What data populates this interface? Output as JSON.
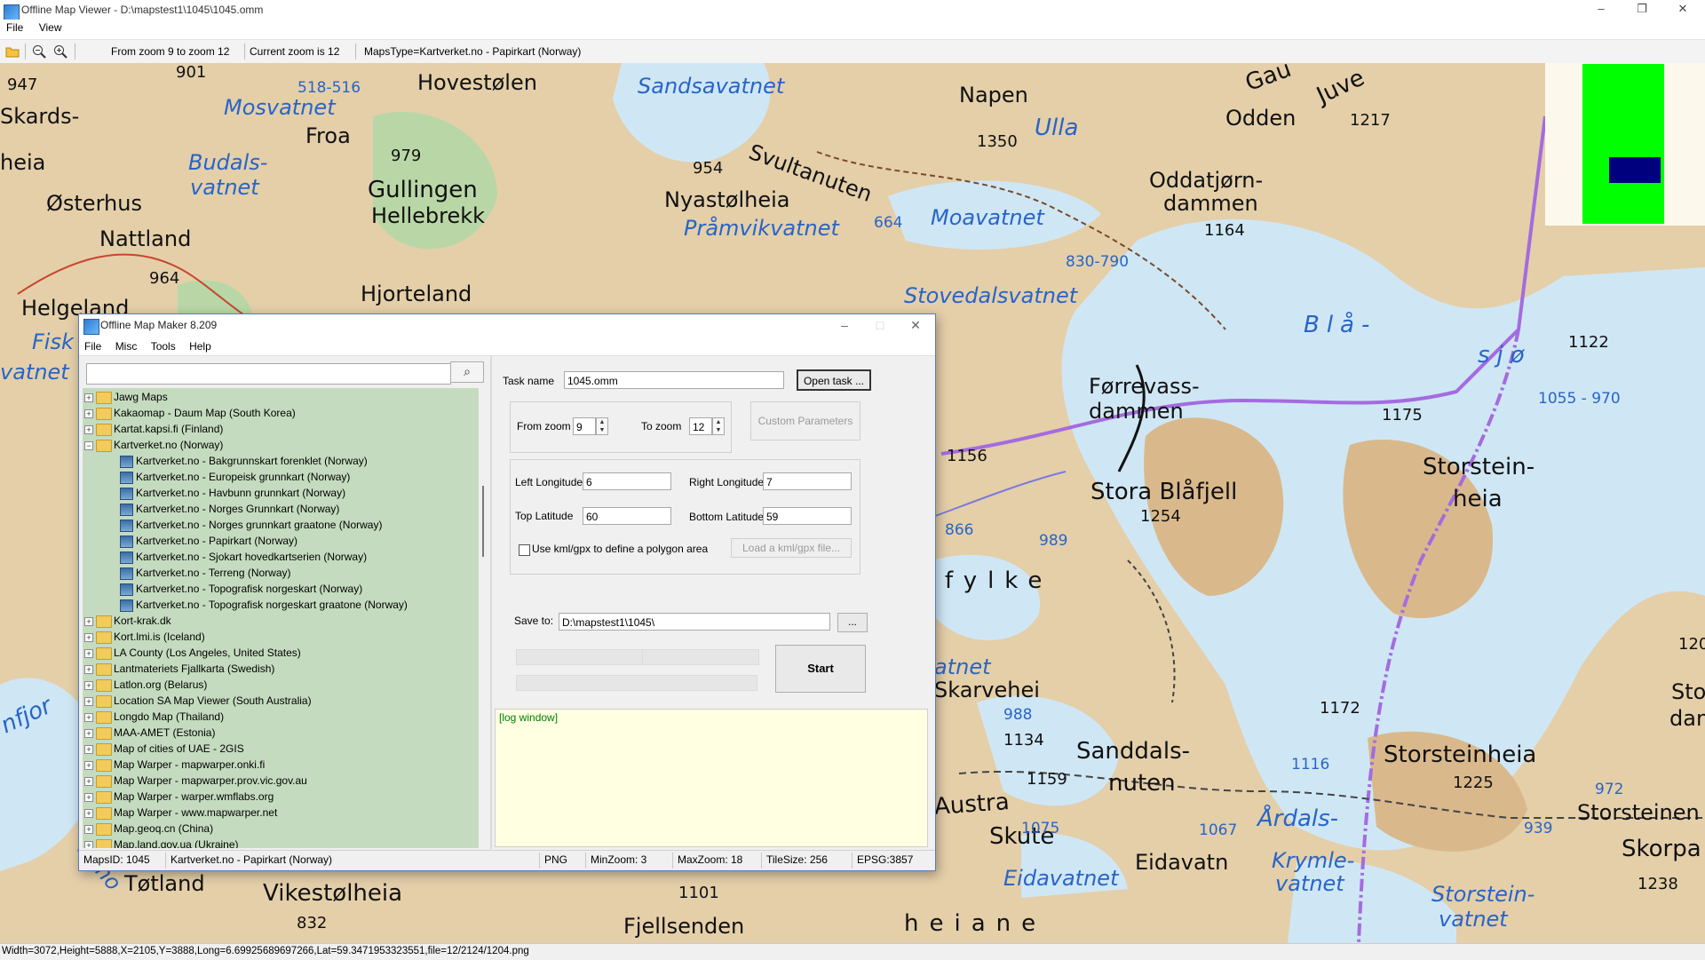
{
  "window": {
    "title": "Offline Map Viewer - D:\\mapstest1\\1045\\1045.omm",
    "minimize": "–",
    "restore": "❐",
    "close": "✕"
  },
  "menu": [
    "File",
    "View"
  ],
  "toolbar": {
    "zoom_range": "From zoom 9 to zoom 12",
    "current_zoom": "Current zoom is 12",
    "maps_type": "MapsType=Kartverket.no - Papirkart (Norway)",
    "icons": [
      "open-folder-icon",
      "zoom-out-icon",
      "zoom-in-icon"
    ]
  },
  "map": {
    "labels": [
      {
        "text": "947",
        "cls": "num"
      },
      {
        "text": "901",
        "cls": "num"
      },
      {
        "text": "518-516",
        "cls": "numblue"
      },
      {
        "text": "Hovestølen",
        "cls": "med"
      },
      {
        "text": "Sandsavatnet",
        "cls": "water med"
      },
      {
        "text": "Napen",
        "cls": "med"
      },
      {
        "text": "Odden",
        "cls": "med"
      },
      {
        "text": "1217",
        "cls": "num"
      },
      {
        "text": "Skards-",
        "cls": "med"
      },
      {
        "text": "Mosvatnet",
        "cls": "water med"
      },
      {
        "text": "Froa",
        "cls": "med"
      },
      {
        "text": "1350",
        "cls": "num"
      },
      {
        "text": "Ulla",
        "cls": "water big"
      },
      {
        "text": "heia",
        "cls": "med"
      },
      {
        "text": "Budals-",
        "cls": "water med"
      },
      {
        "text": "vatnet",
        "cls": "water med"
      },
      {
        "text": "979",
        "cls": "num"
      },
      {
        "text": "954",
        "cls": "num"
      },
      {
        "text": "Svultanuten",
        "cls": "med"
      },
      {
        "text": "Oddatjørn-",
        "cls": "med"
      },
      {
        "text": "dammen",
        "cls": "med"
      },
      {
        "text": "Østerhus",
        "cls": "med"
      },
      {
        "text": "Gullingen",
        "cls": "big"
      },
      {
        "text": "Hellebrekk",
        "cls": "med"
      },
      {
        "text": "Nyastølheia",
        "cls": "med"
      },
      {
        "text": "Pråmvikvatnet",
        "cls": "water med"
      },
      {
        "text": "664",
        "cls": "numblue"
      },
      {
        "text": "Moavatnet",
        "cls": "water med"
      },
      {
        "text": "1164",
        "cls": "num"
      },
      {
        "text": "Nattland",
        "cls": "med"
      },
      {
        "text": "830-790",
        "cls": "numblue"
      },
      {
        "text": "964",
        "cls": "num"
      },
      {
        "text": "Hjorteland",
        "cls": "med"
      },
      {
        "text": "Helgeland",
        "cls": "med"
      },
      {
        "text": "Stovedalsvatnet",
        "cls": "water med"
      },
      {
        "text": "Blå-",
        "cls": "water big"
      },
      {
        "text": "sjø",
        "cls": "water big"
      },
      {
        "text": "1122",
        "cls": "num"
      },
      {
        "text": "Førrevass-",
        "cls": "med"
      },
      {
        "text": "dammen",
        "cls": "med"
      },
      {
        "text": "1175",
        "cls": "num"
      },
      {
        "text": "1055 - 970",
        "cls": "numblue"
      },
      {
        "text": "1156",
        "cls": "num"
      },
      {
        "text": "Stora Blåfjell",
        "cls": "big"
      },
      {
        "text": "Storstein-",
        "cls": "big"
      },
      {
        "text": "heia",
        "cls": "big"
      },
      {
        "text": "1254",
        "cls": "num"
      },
      {
        "text": "866",
        "cls": "numblue"
      },
      {
        "text": "989",
        "cls": "numblue"
      },
      {
        "text": "fylke",
        "cls": "big"
      },
      {
        "text": "Skarvehei",
        "cls": "med"
      },
      {
        "text": "988",
        "cls": "numblue"
      },
      {
        "text": "1172",
        "cls": "num"
      },
      {
        "text": "1134",
        "cls": "num"
      },
      {
        "text": "Sanddals-",
        "cls": "big"
      },
      {
        "text": "nuten",
        "cls": "big"
      },
      {
        "text": "1159",
        "cls": "num"
      },
      {
        "text": "1116",
        "cls": "numblue"
      },
      {
        "text": "Storsteinheia",
        "cls": "big"
      },
      {
        "text": "1225",
        "cls": "num"
      },
      {
        "text": "Austra",
        "cls": "big"
      },
      {
        "text": "Skute",
        "cls": "big"
      },
      {
        "text": "1075",
        "cls": "numblue"
      },
      {
        "text": "1067",
        "cls": "numblue"
      },
      {
        "text": "Årdals-",
        "cls": "water big"
      },
      {
        "text": "Krymle-",
        "cls": "water med"
      },
      {
        "text": "vatnet",
        "cls": "water med"
      },
      {
        "text": "Storsteinen",
        "cls": "med"
      },
      {
        "text": "939",
        "cls": "numblue"
      },
      {
        "text": "972",
        "cls": "numblue"
      },
      {
        "text": "Eidavatnet",
        "cls": "water med"
      },
      {
        "text": "Eidavatn",
        "cls": "med"
      },
      {
        "text": "Storstein-",
        "cls": "water med"
      },
      {
        "text": "vatnet",
        "cls": "water med"
      },
      {
        "text": "1238",
        "cls": "num"
      },
      {
        "text": "Tøtland",
        "cls": "med"
      },
      {
        "text": "Vikestølheia",
        "cls": "big"
      },
      {
        "text": "1101",
        "cls": "num"
      },
      {
        "text": "832",
        "cls": "num"
      },
      {
        "text": "Fjellsenden",
        "cls": "med"
      },
      {
        "text": "heiane",
        "cls": "big"
      },
      {
        "text": "120",
        "cls": "num"
      },
      {
        "text": "Stor",
        "cls": "med"
      },
      {
        "text": "dan",
        "cls": "med"
      },
      {
        "text": "Skorpa",
        "cls": "big"
      },
      {
        "text": "Fisk",
        "cls": "water med"
      },
      {
        "text": "vatnet",
        "cls": "water med"
      },
      {
        "text": "nfjor",
        "cls": "water big"
      },
      {
        "text": "ormo",
        "cls": "water med"
      },
      {
        "text": "Gau",
        "cls": "big"
      },
      {
        "text": "Juve",
        "cls": "big"
      },
      {
        "text": "atnet",
        "cls": "water med"
      }
    ]
  },
  "statusbar": "Width=3072,Height=5888,X=2105,Y=3888,Long=6.69925689697266,Lat=59.3471953323551,file=12/2124/1204.png",
  "dialog": {
    "title": "Offline Map Maker 8.209",
    "menu": [
      "File",
      "Misc",
      "Tools",
      "Help"
    ],
    "search_placeholder": "",
    "search_icon": "⌕",
    "tree": [
      {
        "text": "Jawg Maps",
        "level": 0,
        "type": "folder",
        "exp": "+"
      },
      {
        "text": "Kakaomap - Daum Map (South Korea)",
        "level": 0,
        "type": "folder",
        "exp": "+"
      },
      {
        "text": "Kartat.kapsi.fi (Finland)",
        "level": 0,
        "type": "folder",
        "exp": "+"
      },
      {
        "text": "Kartverket.no (Norway)",
        "level": 0,
        "type": "folder-open",
        "exp": "−"
      },
      {
        "text": "Kartverket.no - Bakgrunnskart forenklet (Norway)",
        "level": 1,
        "type": "map"
      },
      {
        "text": "Kartverket.no - Europeisk grunnkart (Norway)",
        "level": 1,
        "type": "map"
      },
      {
        "text": "Kartverket.no - Havbunn grunnkart (Norway)",
        "level": 1,
        "type": "map"
      },
      {
        "text": "Kartverket.no - Norges Grunnkart (Norway)",
        "level": 1,
        "type": "map"
      },
      {
        "text": "Kartverket.no - Norges grunnkart graatone (Norway)",
        "level": 1,
        "type": "map"
      },
      {
        "text": "Kartverket.no - Papirkart (Norway)",
        "level": 1,
        "type": "map"
      },
      {
        "text": "Kartverket.no - Sjokart hovedkartserien (Norway)",
        "level": 1,
        "type": "map"
      },
      {
        "text": "Kartverket.no - Terreng (Norway)",
        "level": 1,
        "type": "map"
      },
      {
        "text": "Kartverket.no - Topografisk norgeskart (Norway)",
        "level": 1,
        "type": "map"
      },
      {
        "text": "Kartverket.no - Topografisk norgeskart graatone (Norway)",
        "level": 1,
        "type": "map"
      },
      {
        "text": "Kort-krak.dk",
        "level": 0,
        "type": "folder",
        "exp": "+"
      },
      {
        "text": "Kort.lmi.is (Iceland)",
        "level": 0,
        "type": "folder",
        "exp": "+"
      },
      {
        "text": "LA County (Los Angeles, United States)",
        "level": 0,
        "type": "folder",
        "exp": "+"
      },
      {
        "text": "Lantmateriets Fjallkarta (Swedish)",
        "level": 0,
        "type": "folder",
        "exp": "+"
      },
      {
        "text": "Latlon.org (Belarus)",
        "level": 0,
        "type": "folder",
        "exp": "+"
      },
      {
        "text": "Location SA Map Viewer (South Australia)",
        "level": 0,
        "type": "folder",
        "exp": "+"
      },
      {
        "text": "Longdo Map (Thailand)",
        "level": 0,
        "type": "folder",
        "exp": "+"
      },
      {
        "text": "MAA-AMET (Estonia)",
        "level": 0,
        "type": "folder",
        "exp": "+"
      },
      {
        "text": "Map of cities of UAE - 2GIS",
        "level": 0,
        "type": "folder",
        "exp": "+"
      },
      {
        "text": "Map Warper - mapwarper.onki.fi",
        "level": 0,
        "type": "folder",
        "exp": "+"
      },
      {
        "text": "Map Warper - mapwarper.prov.vic.gov.au",
        "level": 0,
        "type": "folder",
        "exp": "+"
      },
      {
        "text": "Map Warper - warper.wmflabs.org",
        "level": 0,
        "type": "folder",
        "exp": "+"
      },
      {
        "text": "Map Warper - www.mapwarper.net",
        "level": 0,
        "type": "folder",
        "exp": "+"
      },
      {
        "text": "Map.geoq.cn (China)",
        "level": 0,
        "type": "folder",
        "exp": "+"
      },
      {
        "text": "Map.land.gov.ua (Ukraine)",
        "level": 0,
        "type": "folder",
        "exp": "+"
      }
    ],
    "task_name_label": "Task name",
    "task_name_value": "1045.omm",
    "open_task": "Open task ...",
    "from_zoom_label": "From zoom",
    "from_zoom_value": "9",
    "to_zoom_label": "To zoom",
    "to_zoom_value": "12",
    "custom_params": "Custom Parameters",
    "left_lon_label": "Left Longitude",
    "left_lon_value": "6",
    "right_lon_label": "Right Longitude",
    "right_lon_value": "7",
    "top_lat_label": "Top Latitude",
    "top_lat_value": "60",
    "bottom_lat_label": "Bottom Latitude",
    "bottom_lat_value": "59",
    "kml_label": "Use kml/gpx to define a polygon area",
    "load_kml": "Load a kml/gpx file...",
    "save_to_label": "Save to:",
    "save_to_value": "D:\\mapstest1\\1045\\",
    "browse": "...",
    "start": "Start",
    "log": "[log window]",
    "status": {
      "maps_id": "MapsID: 1045",
      "maps_name": "Kartverket.no - Papirkart (Norway)",
      "format": "PNG",
      "min_zoom": "MinZoom: 3",
      "max_zoom": "MaxZoom: 18",
      "tile_size": "TileSize: 256",
      "epsg": "EPSG:3857"
    }
  }
}
